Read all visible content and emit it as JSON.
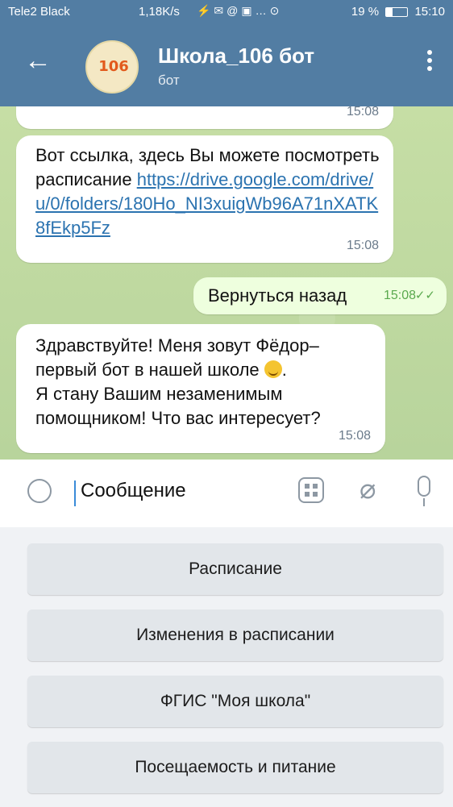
{
  "status_bar": {
    "carrier": "Tele2 Black",
    "speed": "1,18K/s",
    "battery": "19 %",
    "time": "15:10"
  },
  "header": {
    "title": "Школа_106 бот",
    "subtitle": "бот",
    "avatar_text": "106"
  },
  "messages": [
    {
      "time": "15:08"
    },
    {
      "text_before": "Вот ссылка, здесь Вы можете посмотреть расписание ",
      "link": "https://drive.google.com/drive/u/0/folders/180Ho_NI3xuigWb96A71nXATK8fEkp5Fz",
      "time": "15:08"
    },
    {
      "text": "Вернуться назад",
      "time": "15:08"
    },
    {
      "line1": "Здравствуйте! Меня зовут Фёдор–",
      "line2": "первый  бот в нашей школе",
      "line3": "Я стану Вашим незаменимым",
      "line4": "помощником! Что вас интересует?",
      "time": "15:08"
    }
  ],
  "input": {
    "placeholder": "Сообщение"
  },
  "keyboard_buttons": [
    "Расписание",
    "Изменения в расписании",
    "ФГИС \"Моя школа\"",
    "Посещаемость и питание"
  ]
}
